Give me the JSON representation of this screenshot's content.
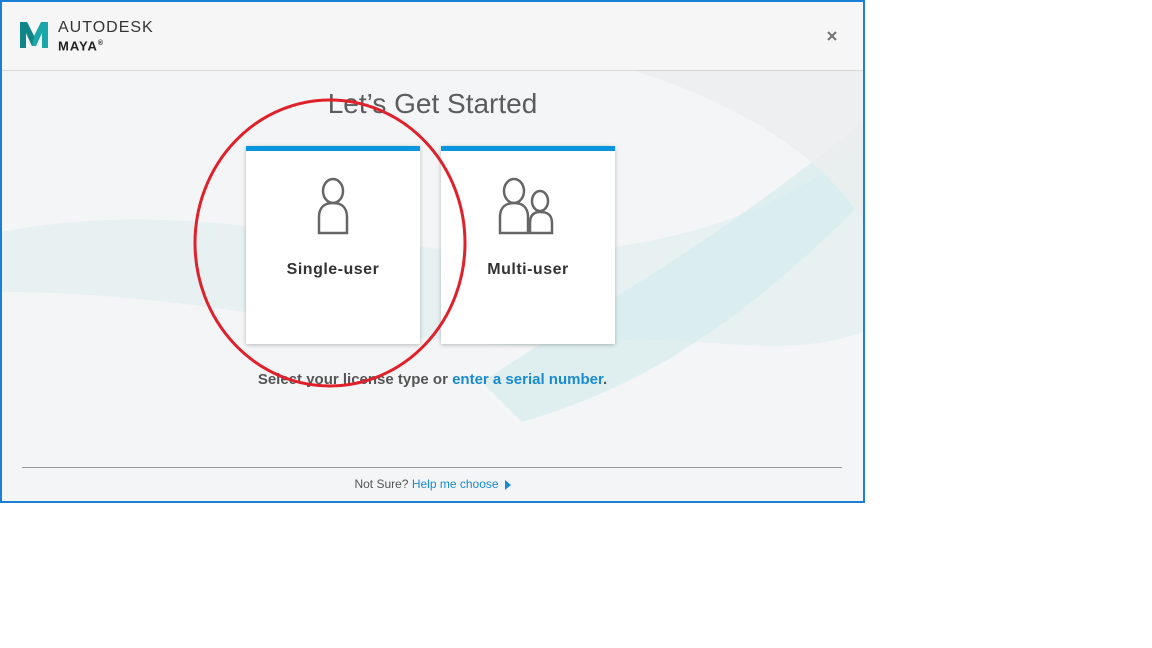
{
  "header": {
    "company": "AUTODESK",
    "product": "MAYA",
    "registered_mark": "®"
  },
  "title": "Let’s Get Started",
  "cards": [
    {
      "label": "Single-user",
      "icon": "single-user-icon"
    },
    {
      "label": "Multi-user",
      "icon": "multi-user-icon"
    }
  ],
  "prompt": {
    "text": "Select your license type or ",
    "link": "enter a serial number",
    "suffix": "."
  },
  "footer": {
    "question": "Not Sure? ",
    "link": "Help me choose"
  },
  "colors": {
    "accent": "#0a96de",
    "link": "#1a8bd0",
    "window_border": "#1a7fd6",
    "annotation_circle": "#e0202a"
  }
}
